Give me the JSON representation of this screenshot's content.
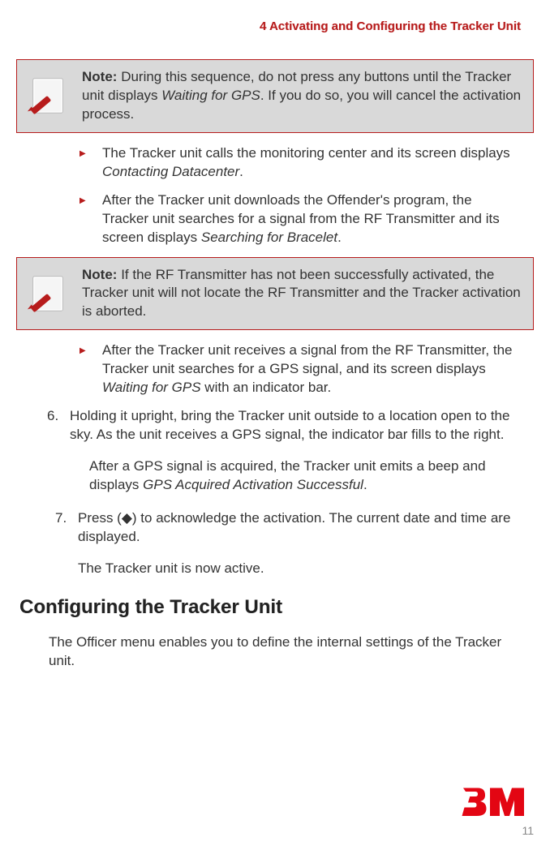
{
  "header": {
    "chapter": "4   Activating and Configuring the Tracker Unit"
  },
  "note1": {
    "label": "Note:",
    "pre": "During this sequence, do not press any buttons until the Tracker unit displays ",
    "italic": "Waiting for GPS",
    "post": ". If you do so, you will cancel the activation process."
  },
  "bulletsA": {
    "b1_pre": "The Tracker unit calls the monitoring center and its screen displays ",
    "b1_italic": "Contacting Datacenter",
    "b1_post": ".",
    "b2_pre": "After the Tracker unit downloads the Offender's program, the Tracker unit searches for a signal from the RF Transmitter and its screen displays ",
    "b2_italic": "Searching for Bracelet",
    "b2_post": "."
  },
  "note2": {
    "label": "Note:",
    "text": "If the RF Transmitter has not been successfully activated, the Tracker unit will not locate the RF Transmitter and the Tracker activation is aborted."
  },
  "bulletsB": {
    "b1_pre": "After the Tracker unit receives a signal from the RF Transmitter, the Tracker unit searches for a GPS signal, and its screen displays ",
    "b1_italic": "Waiting for GPS",
    "b1_post": " with an indicator bar."
  },
  "step6": {
    "num": "6.",
    "text": "Holding it upright, bring the Tracker unit outside to a location open to the sky. As the unit receives a GPS signal, the indicator bar fills to the right."
  },
  "step6b": {
    "pre": "After a GPS signal is acquired, the Tracker unit emits a beep and displays ",
    "italic": "GPS Acquired Activation Successful",
    "post": "."
  },
  "step7": {
    "num": "7.",
    "text": "Press (◆) to acknowledge the activation. The current date and time are displayed."
  },
  "active_line": "The Tracker unit is now active.",
  "heading": "Configuring the Tracker Unit",
  "config_intro": "The Officer menu enables you to define the internal settings of the Tracker unit.",
  "footer": {
    "page": "11"
  }
}
